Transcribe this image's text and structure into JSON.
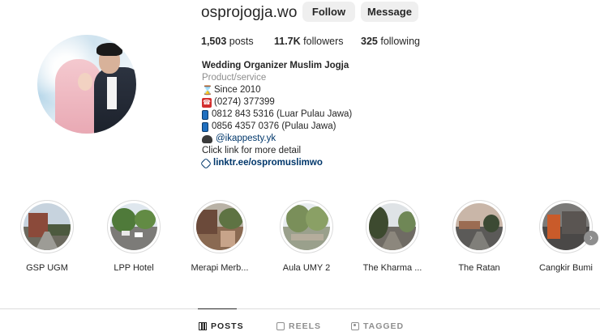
{
  "profile": {
    "username": "osprojogja.wo",
    "follow_label": "Follow",
    "message_label": "Message",
    "stats": {
      "posts_count": "1,503",
      "posts_label": "posts",
      "followers_count": "11.7K",
      "followers_label": "followers",
      "following_count": "325",
      "following_label": "following"
    },
    "bio": {
      "name": "Wedding Organizer Muslim Jogja",
      "category": "Product/service",
      "lines": [
        {
          "icon": "hourglass-icon",
          "text": "Since 2010"
        },
        {
          "icon": "telephone-icon",
          "text": "(0274) 377399"
        },
        {
          "icon": "mobile-phone-icon",
          "text": "0812 843 5316 (Luar Pulau Jawa)"
        },
        {
          "icon": "mobile-phone-icon",
          "text": "0856 4357 0376 (Pulau Jawa)"
        },
        {
          "icon": "ninja-icon",
          "text": "@ikappesty.yk"
        }
      ],
      "note": "Click link for more detail",
      "link": "linktr.ee/ospromuslimwo"
    }
  },
  "highlights": [
    {
      "label": "GSP UGM"
    },
    {
      "label": "LPP Hotel"
    },
    {
      "label": "Merapi Merb..."
    },
    {
      "label": "Aula UMY 2"
    },
    {
      "label": "The Kharma ..."
    },
    {
      "label": "The Ratan"
    },
    {
      "label": "Cangkir Bumi"
    }
  ],
  "tabs": [
    {
      "label": "POSTS",
      "icon": "grid-icon",
      "active": true
    },
    {
      "label": "REELS",
      "icon": "reels-icon",
      "active": false
    },
    {
      "label": "TAGGED",
      "icon": "tagged-icon",
      "active": false
    }
  ],
  "colors": {
    "button_bg": "#efefef",
    "link": "#00376b",
    "secondary_text": "#8e8e8e"
  }
}
